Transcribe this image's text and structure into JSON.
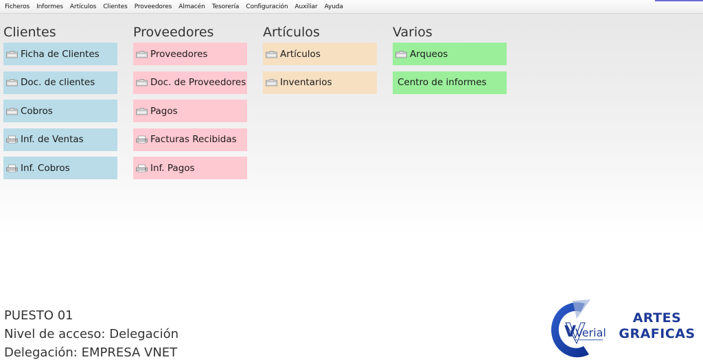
{
  "menu": [
    "Ficheros",
    "Informes",
    "Artículos",
    "Clientes",
    "Proveedores",
    "Almacén",
    "Tesorería",
    "Configuración",
    "Auxiliar",
    "Ayuda"
  ],
  "groups": {
    "clientes": {
      "title": "Clientes",
      "color": "#b9dce8",
      "items": [
        "Ficha de Clientes",
        "Doc. de clientes",
        "Cobros",
        "Inf. de Ventas",
        "Inf. Cobros"
      ]
    },
    "proveedores": {
      "title": "Proveedores",
      "color": "#ffc9d1",
      "items": [
        "Proveedores",
        "Doc. de Proveedores",
        "Pagos",
        "Facturas Recibidas",
        "Inf. Pagos"
      ]
    },
    "articulos": {
      "title": "Artículos",
      "color": "#f7e0c2",
      "items": [
        "Artículos",
        "Inventarios"
      ]
    },
    "varios": {
      "title": "Varios",
      "color": "#9bef9b",
      "items": [
        "Arqueos",
        "Centro de informes"
      ]
    }
  },
  "icons": {
    "folder": "folder-icon",
    "report": "report-printer-icon"
  },
  "status": {
    "puesto": "PUESTO 01",
    "nivel": "Nivel de acceso: Delegación",
    "delegacion": "Delegación: EMPRESA VNET"
  },
  "branding": {
    "verial": "Verial",
    "artes_line1": "ARTES",
    "artes_line2": "GRAFICAS",
    "brand_color": "#1e3a97"
  }
}
